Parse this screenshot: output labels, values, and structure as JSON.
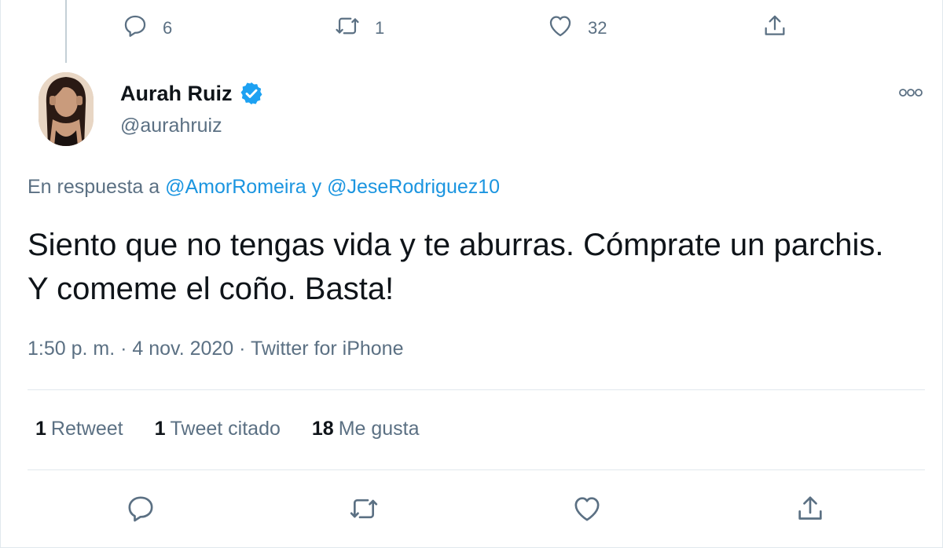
{
  "previous_tweet": {
    "reply_count": "6",
    "retweet_count": "1",
    "like_count": "32"
  },
  "tweet": {
    "author_name": "Aurah Ruiz",
    "author_handle": "@aurahruiz",
    "reply_prefix": "En respuesta a ",
    "reply_user_1": "@AmorRomeira",
    "reply_joiner": " y ",
    "reply_user_2": "@JeseRodriguez10",
    "text": "Siento que no tengas vida y te aburras. Cómprate un parchis. Y comeme el coño. Basta!",
    "meta": "1:50 p. m. · 4 nov. 2020 · Twitter for iPhone"
  },
  "stats": {
    "retweets_num": "1",
    "retweets_label": "Retweet",
    "quotes_num": "1",
    "quotes_label": "Tweet citado",
    "likes_num": "18",
    "likes_label": "Me gusta"
  },
  "icons": {
    "reply": "reply-icon",
    "retweet": "retweet-icon",
    "like": "heart-icon",
    "share": "share-icon",
    "verified": "verified-badge-icon",
    "more": "more-icon"
  },
  "colors": {
    "accent": "#1b95e0",
    "muted": "#5b7083",
    "text": "#0f1419",
    "divider": "#e1e8ed"
  }
}
